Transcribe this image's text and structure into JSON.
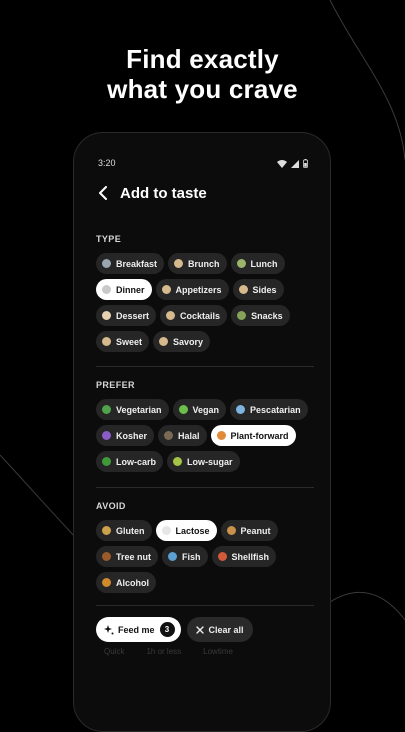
{
  "headline": {
    "line1": "Find exactly",
    "line2": "what you crave"
  },
  "status_bar": {
    "time": "3:20",
    "icons": [
      "wifi-icon",
      "signal-icon",
      "battery-icon"
    ]
  },
  "app_bar": {
    "title": "Add to taste",
    "back_icon": "chevron-left-icon"
  },
  "sections": {
    "type": {
      "label": "TYPE",
      "chips": [
        {
          "label": "Breakfast",
          "selected": false,
          "dot": "#9aa7b0"
        },
        {
          "label": "Brunch",
          "selected": false,
          "dot": "#d6b98c"
        },
        {
          "label": "Lunch",
          "selected": false,
          "dot": "#9bb36a"
        },
        {
          "label": "Dinner",
          "selected": true,
          "dot": "#c9c9c9"
        },
        {
          "label": "Appetizers",
          "selected": false,
          "dot": "#d6b98c"
        },
        {
          "label": "Sides",
          "selected": false,
          "dot": "#d6b98c"
        },
        {
          "label": "Dessert",
          "selected": false,
          "dot": "#e7d3b3"
        },
        {
          "label": "Cocktails",
          "selected": false,
          "dot": "#d6b98c"
        },
        {
          "label": "Snacks",
          "selected": false,
          "dot": "#86a35a"
        },
        {
          "label": "Sweet",
          "selected": false,
          "dot": "#d6b98c"
        },
        {
          "label": "Savory",
          "selected": false,
          "dot": "#d6b98c"
        }
      ]
    },
    "prefer": {
      "label": "PREFER",
      "chips": [
        {
          "label": "Vegetarian",
          "selected": false,
          "dot": "#4fa34a"
        },
        {
          "label": "Vegan",
          "selected": false,
          "dot": "#6cbf4a"
        },
        {
          "label": "Pescatarian",
          "selected": false,
          "dot": "#7fb4e0"
        },
        {
          "label": "Kosher",
          "selected": false,
          "dot": "#8a5cc7"
        },
        {
          "label": "Halal",
          "selected": false,
          "dot": "#7a6a55"
        },
        {
          "label": "Plant-forward",
          "selected": true,
          "dot": "#e08a3a"
        },
        {
          "label": "Low-carb",
          "selected": false,
          "dot": "#3f9a3a"
        },
        {
          "label": "Low-sugar",
          "selected": false,
          "dot": "#a3c447"
        }
      ]
    },
    "avoid": {
      "label": "AVOID",
      "chips": [
        {
          "label": "Gluten",
          "selected": false,
          "dot": "#c9a24a"
        },
        {
          "label": "Lactose",
          "selected": true,
          "dot": "#e6e6e6"
        },
        {
          "label": "Peanut",
          "selected": false,
          "dot": "#c9914a"
        },
        {
          "label": "Tree nut",
          "selected": false,
          "dot": "#9a5a2a"
        },
        {
          "label": "Fish",
          "selected": false,
          "dot": "#5aa0d0"
        },
        {
          "label": "Shellfish",
          "selected": false,
          "dot": "#d05a3a"
        },
        {
          "label": "Alcohol",
          "selected": false,
          "dot": "#d08a2a"
        }
      ]
    }
  },
  "actions": {
    "feed_label": "Feed me",
    "feed_count": "3",
    "clear_label": "Clear all"
  },
  "obscured_row": [
    "Quick",
    "1h or less",
    "Lowtime"
  ]
}
